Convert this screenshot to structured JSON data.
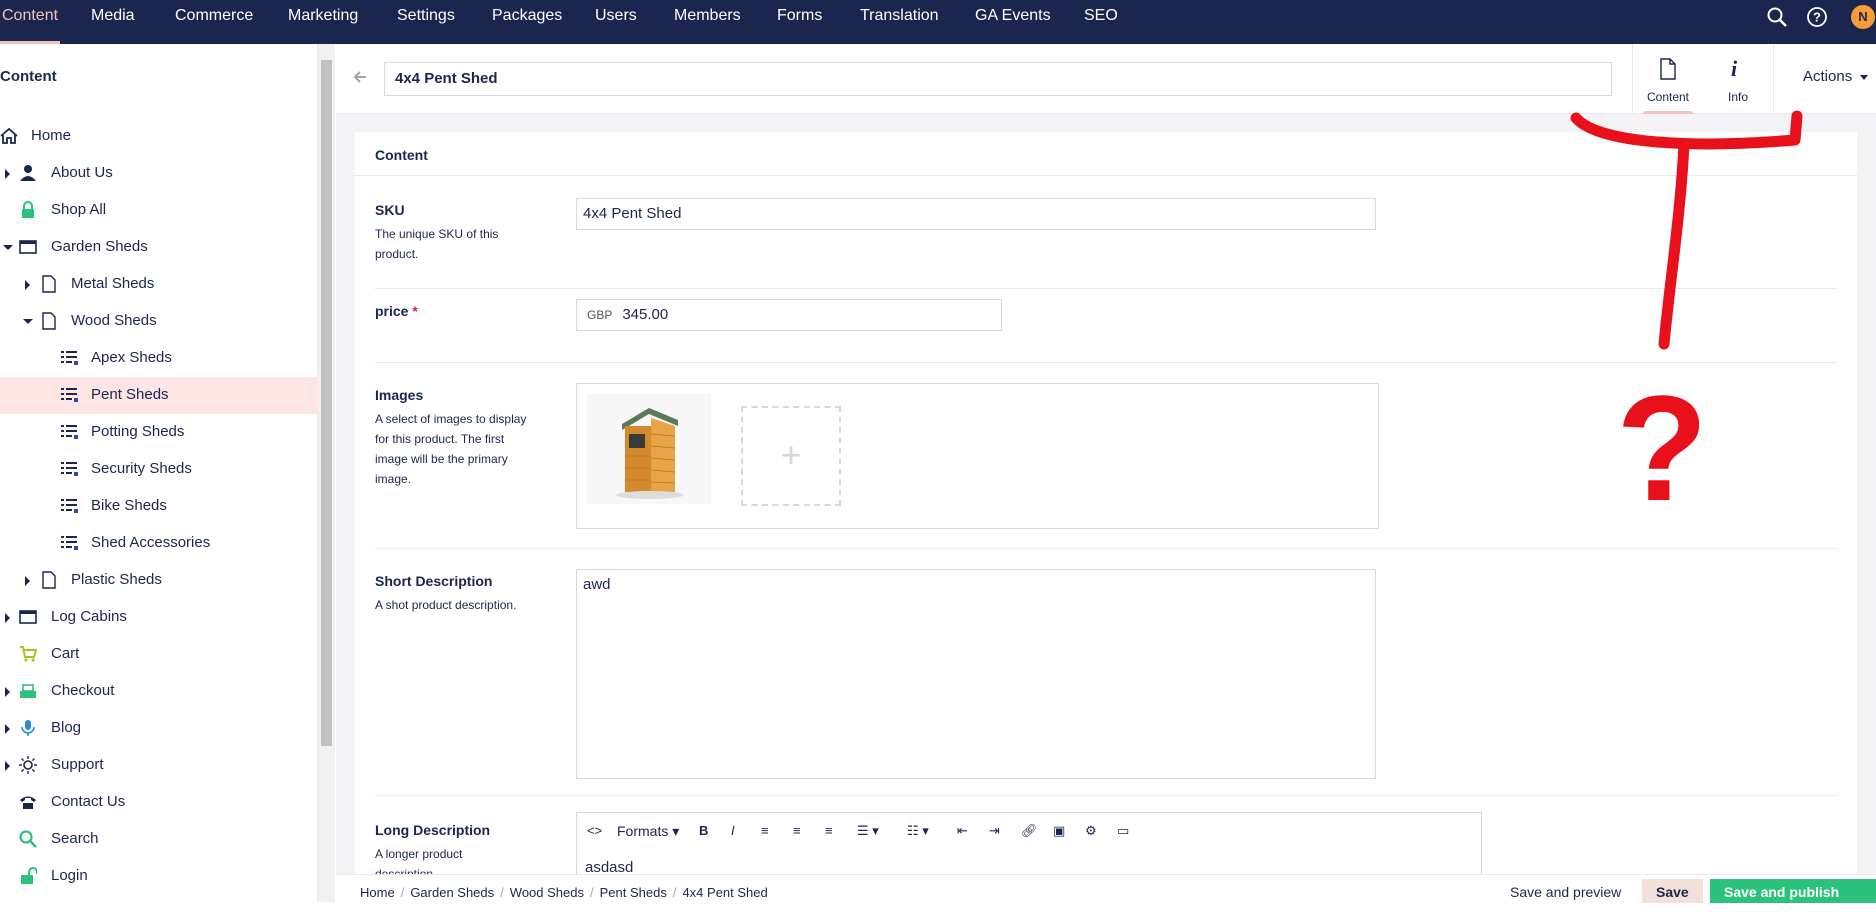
{
  "topnav": {
    "sections": [
      "Content",
      "Media",
      "Commerce",
      "Marketing",
      "Settings",
      "Packages",
      "Users",
      "Members",
      "Forms",
      "Translation",
      "GA Events",
      "SEO"
    ],
    "avatar_initial": "N",
    "icons": [
      "search-icon",
      "help-icon"
    ]
  },
  "sidebar": {
    "title": "Content",
    "items": [
      {
        "label": "Home",
        "icon": "home-icon"
      },
      {
        "label": "About Us",
        "icon": "user-icon"
      },
      {
        "label": "Shop All",
        "icon": "lock-icon"
      },
      {
        "label": "Garden Sheds",
        "icon": "window-icon"
      },
      {
        "label": "Metal Sheds",
        "icon": "document-icon"
      },
      {
        "label": "Wood Sheds",
        "icon": "document-icon"
      },
      {
        "label": "Apex Sheds",
        "icon": "list-icon"
      },
      {
        "label": "Pent Sheds",
        "icon": "list-icon"
      },
      {
        "label": "Potting Sheds",
        "icon": "list-icon"
      },
      {
        "label": "Security Sheds",
        "icon": "list-icon"
      },
      {
        "label": "Bike Sheds",
        "icon": "list-icon"
      },
      {
        "label": "Shed Accessories",
        "icon": "list-icon"
      },
      {
        "label": "Plastic Sheds",
        "icon": "document-icon"
      },
      {
        "label": "Log Cabins",
        "icon": "window-icon"
      },
      {
        "label": "Cart",
        "icon": "cart-icon"
      },
      {
        "label": "Checkout",
        "icon": "register-icon"
      },
      {
        "label": "Blog",
        "icon": "microphone-icon"
      },
      {
        "label": "Support",
        "icon": "sun-icon"
      },
      {
        "label": "Contact Us",
        "icon": "phone-icon"
      },
      {
        "label": "Search",
        "icon": "search-icon"
      },
      {
        "label": "Login",
        "icon": "unlock-icon"
      }
    ]
  },
  "editor": {
    "name": "4x4 Pent Shed",
    "tabs": [
      {
        "label": "Content",
        "icon": "document-icon"
      },
      {
        "label": "Info",
        "icon": "info-icon"
      }
    ],
    "actions_label": "Actions",
    "group_title": "Content",
    "props": {
      "sku": {
        "label": "SKU",
        "desc": "The unique SKU of this product.",
        "value": "4x4 Pent Shed"
      },
      "price": {
        "label": "price",
        "required": "*",
        "currency": "GBP",
        "value": "345.00"
      },
      "images": {
        "label": "Images",
        "desc": "A select of images to display for this product. The first image will be the primary image.",
        "add": "+"
      },
      "short_desc": {
        "label": "Short Description",
        "desc": "A shot product description.",
        "value": "awd"
      },
      "long_desc": {
        "label": "Long Description",
        "desc": "A longer product description.",
        "value": "asdasd",
        "formats_label": "Formats"
      }
    }
  },
  "footer": {
    "breadcrumbs": [
      "Home",
      "Garden Sheds",
      "Wood Sheds",
      "Pent Sheds",
      "4x4 Pent Shed"
    ],
    "separator": "/",
    "save_preview": "Save and preview",
    "save": "Save",
    "save_publish": "Save and publish"
  },
  "annotation": {
    "glyph": "?",
    "color": "#e8101a"
  },
  "colors": {
    "nav_bg": "#1b264f",
    "accent": "#f5c1bc",
    "publish": "#2bc37c",
    "selected_bg": "#fce5e3"
  }
}
